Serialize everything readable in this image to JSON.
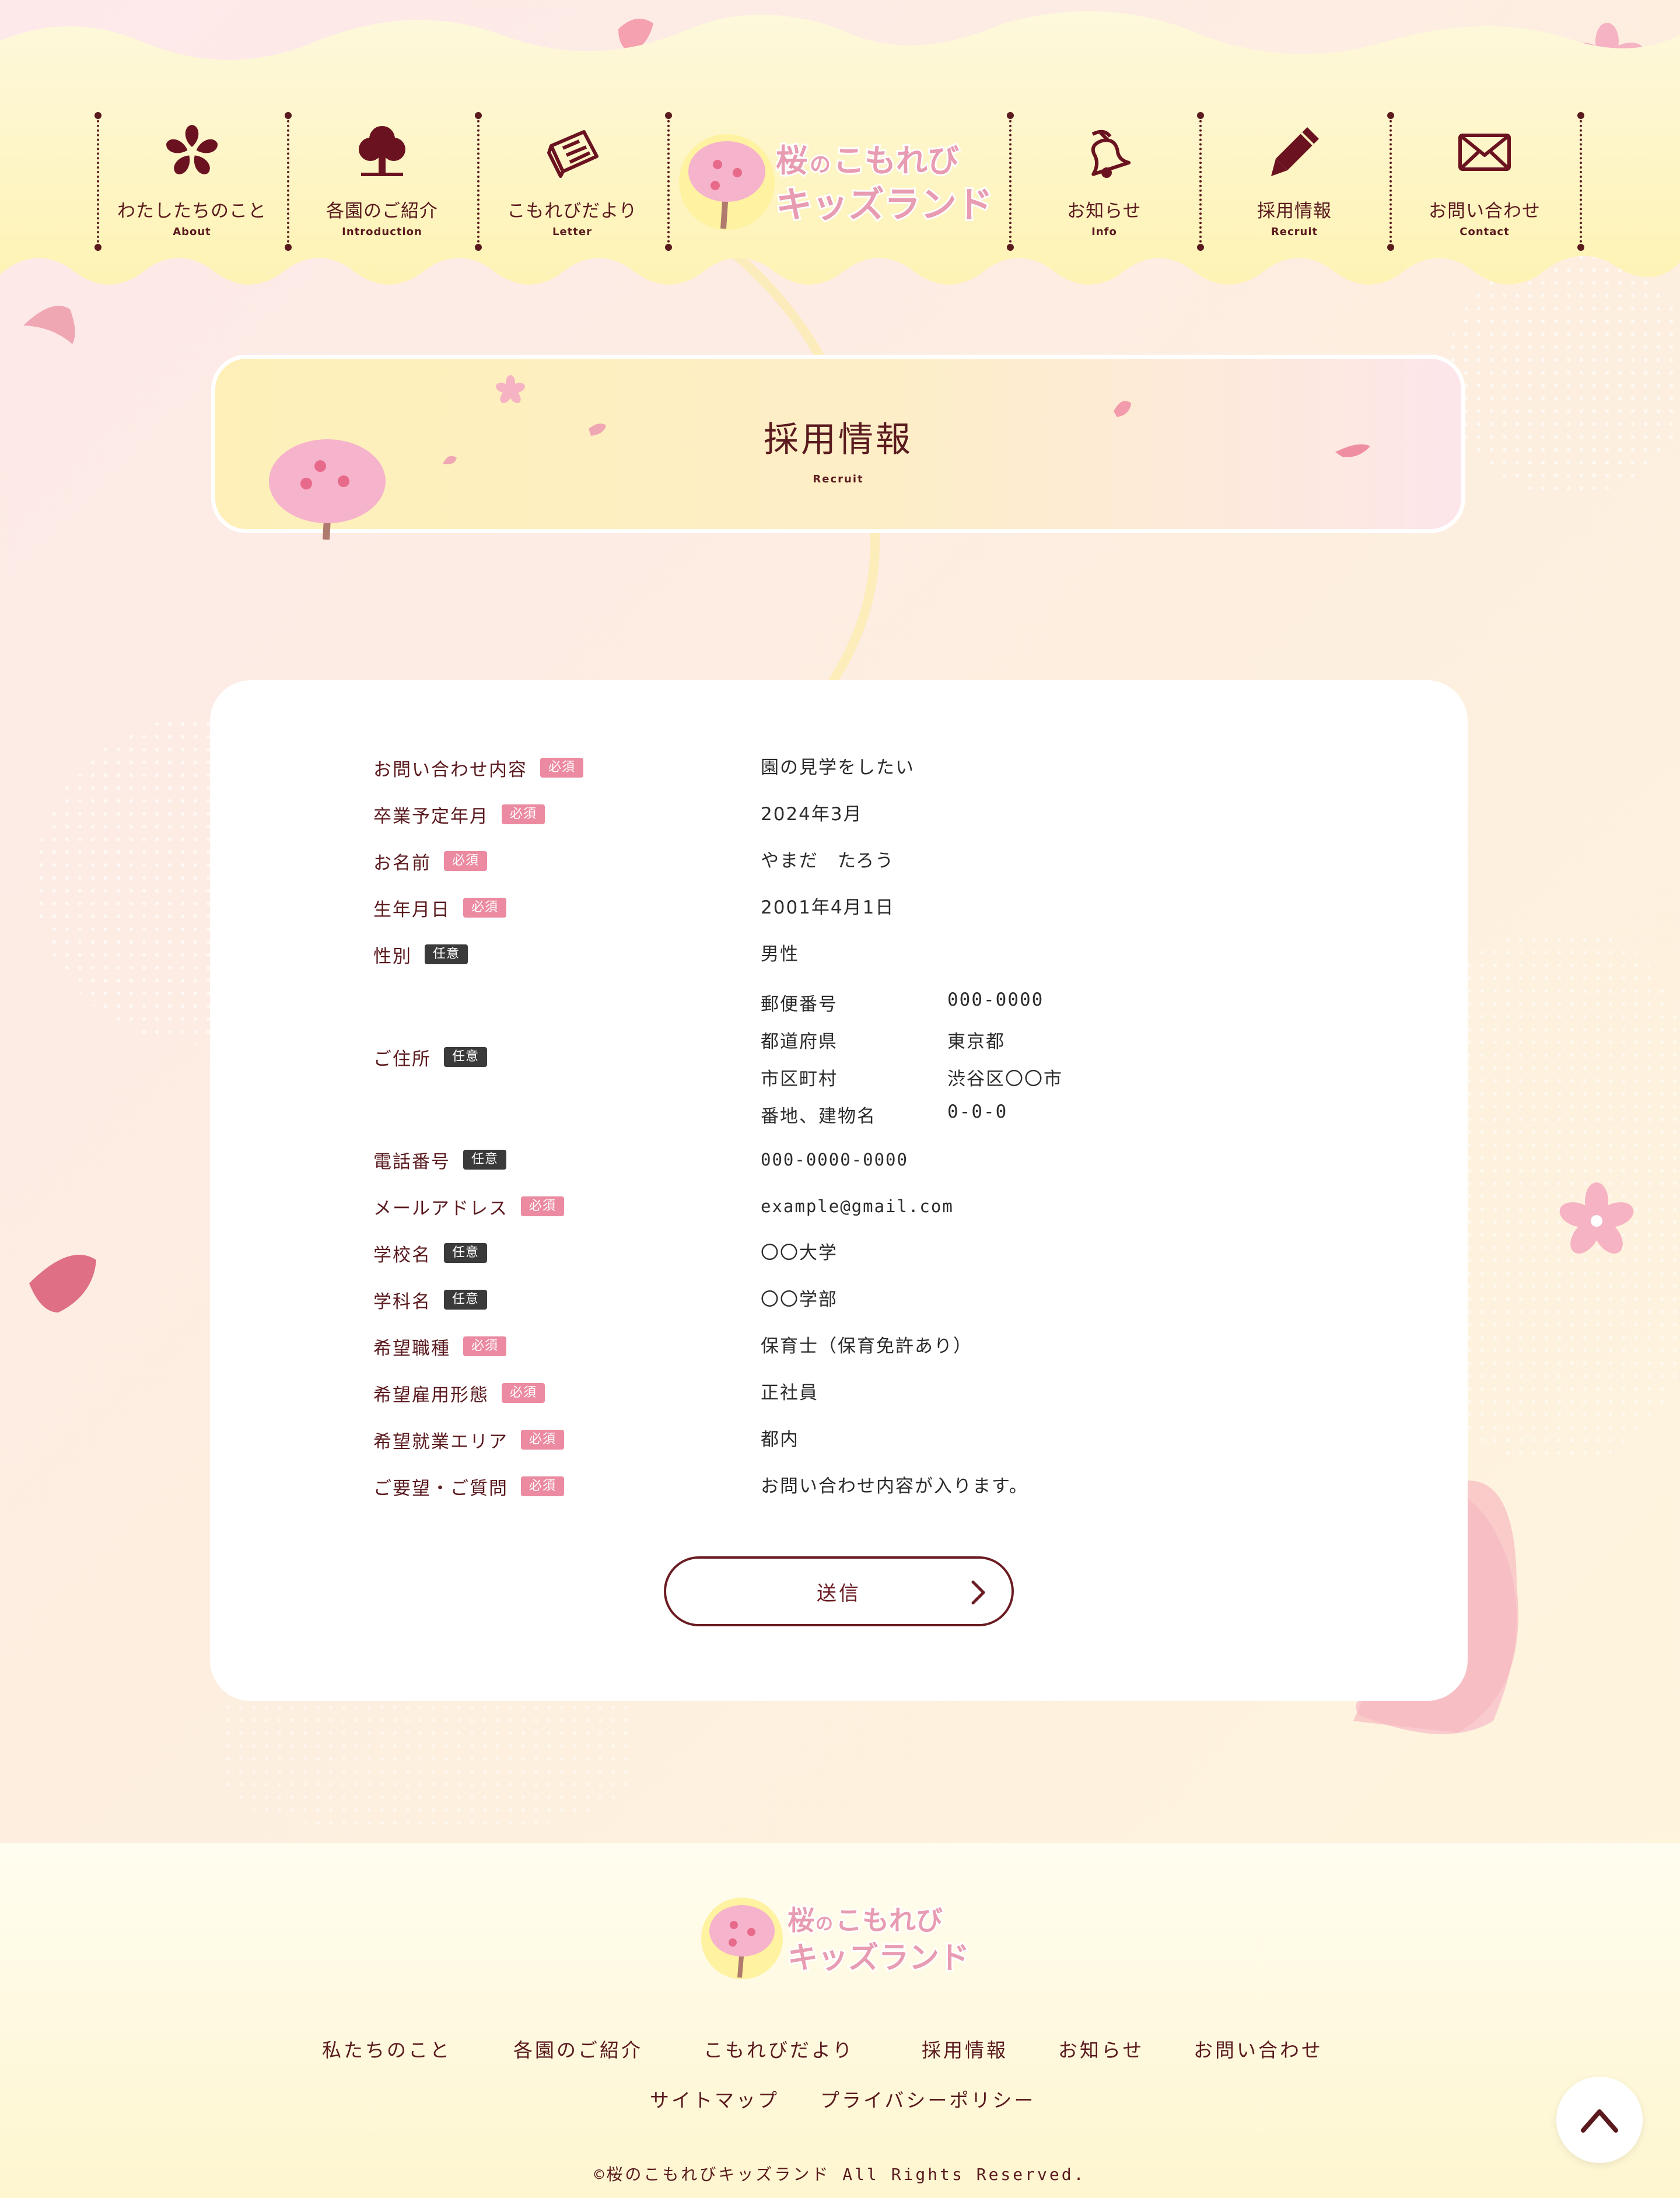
{
  "header": {
    "logo": {
      "line1_a": "桜",
      "line1_b": "の",
      "line1_c": "こもれび",
      "line2": "キッズランド"
    },
    "nav": [
      {
        "label": "わたしたちのこと",
        "en": "About",
        "icon": "sakura-icon"
      },
      {
        "label": "各園のご紹介",
        "en": "Introduction",
        "icon": "tree-icon"
      },
      {
        "label": "こもれびだより",
        "en": "Letter",
        "icon": "newspaper-icon"
      },
      {
        "label": "お知らせ",
        "en": "Info",
        "icon": "bell-icon"
      },
      {
        "label": "採用情報",
        "en": "Recruit",
        "icon": "pencil-icon"
      },
      {
        "label": "お問い合わせ",
        "en": "Contact",
        "icon": "mail-icon"
      }
    ]
  },
  "page_title": {
    "jp": "採用情報",
    "en": "Recruit"
  },
  "form": {
    "rows": [
      {
        "label": "お問い合わせ内容",
        "badge": "必須",
        "required": true,
        "value": "園の見学をしたい"
      },
      {
        "label": "卒業予定年月",
        "badge": "必須",
        "required": true,
        "value": "2024年3月"
      },
      {
        "label": "お名前",
        "badge": "必須",
        "required": true,
        "value": "やまだ　たろう"
      },
      {
        "label": "生年月日",
        "badge": "必須",
        "required": true,
        "value": "2001年4月1日"
      },
      {
        "label": "性別",
        "badge": "任意",
        "required": false,
        "value": "男性"
      },
      {
        "label": "ご住所",
        "badge": "任意",
        "required": false,
        "value": ""
      },
      {
        "label": "電話番号",
        "badge": "任意",
        "required": false,
        "value": "000-0000-0000"
      },
      {
        "label": "メールアドレス",
        "badge": "必須",
        "required": true,
        "value": "example@gmail.com"
      },
      {
        "label": "学校名",
        "badge": "任意",
        "required": false,
        "value": "〇〇大学"
      },
      {
        "label": "学科名",
        "badge": "任意",
        "required": false,
        "value": "〇〇学部"
      },
      {
        "label": "希望職種",
        "badge": "必須",
        "required": true,
        "value": "保育士（保育免許あり）"
      },
      {
        "label": "希望雇用形態",
        "badge": "必須",
        "required": true,
        "value": "正社員"
      },
      {
        "label": "希望就業エリア",
        "badge": "必須",
        "required": true,
        "value": "都内"
      },
      {
        "label": "ご要望・ご質問",
        "badge": "必須",
        "required": true,
        "value": "お問い合わせ内容が入ります。"
      }
    ],
    "address": [
      {
        "key": "郵便番号",
        "value": "000-0000"
      },
      {
        "key": "都道府県",
        "value": "東京都"
      },
      {
        "key": "市区町村",
        "value": "渋谷区〇〇市"
      },
      {
        "key": "番地、建物名",
        "value": "0-0-0"
      }
    ],
    "submit_label": "送信"
  },
  "footer": {
    "logo": {
      "line1_a": "桜",
      "line1_b": "の",
      "line1_c": "こもれび",
      "line2": "キッズランド"
    },
    "links_row1": [
      "私たちのこと",
      "各園のご紹介",
      "こもれびだより",
      "採用情報",
      "お知らせ",
      "お問い合わせ"
    ],
    "links_row2": [
      "サイトマップ",
      "プライバシーポリシー"
    ],
    "copyright": "©桜のこもれびキッズランド All Rights Reserved."
  },
  "colors": {
    "primary": "#5a1a1e",
    "required_badge": "#eb8aa0",
    "optional_badge": "#3a3a3a",
    "header_bg": "#fef6c4",
    "logo_pink": "#e89cb1"
  },
  "page_top_icon": "chevron-up-icon"
}
